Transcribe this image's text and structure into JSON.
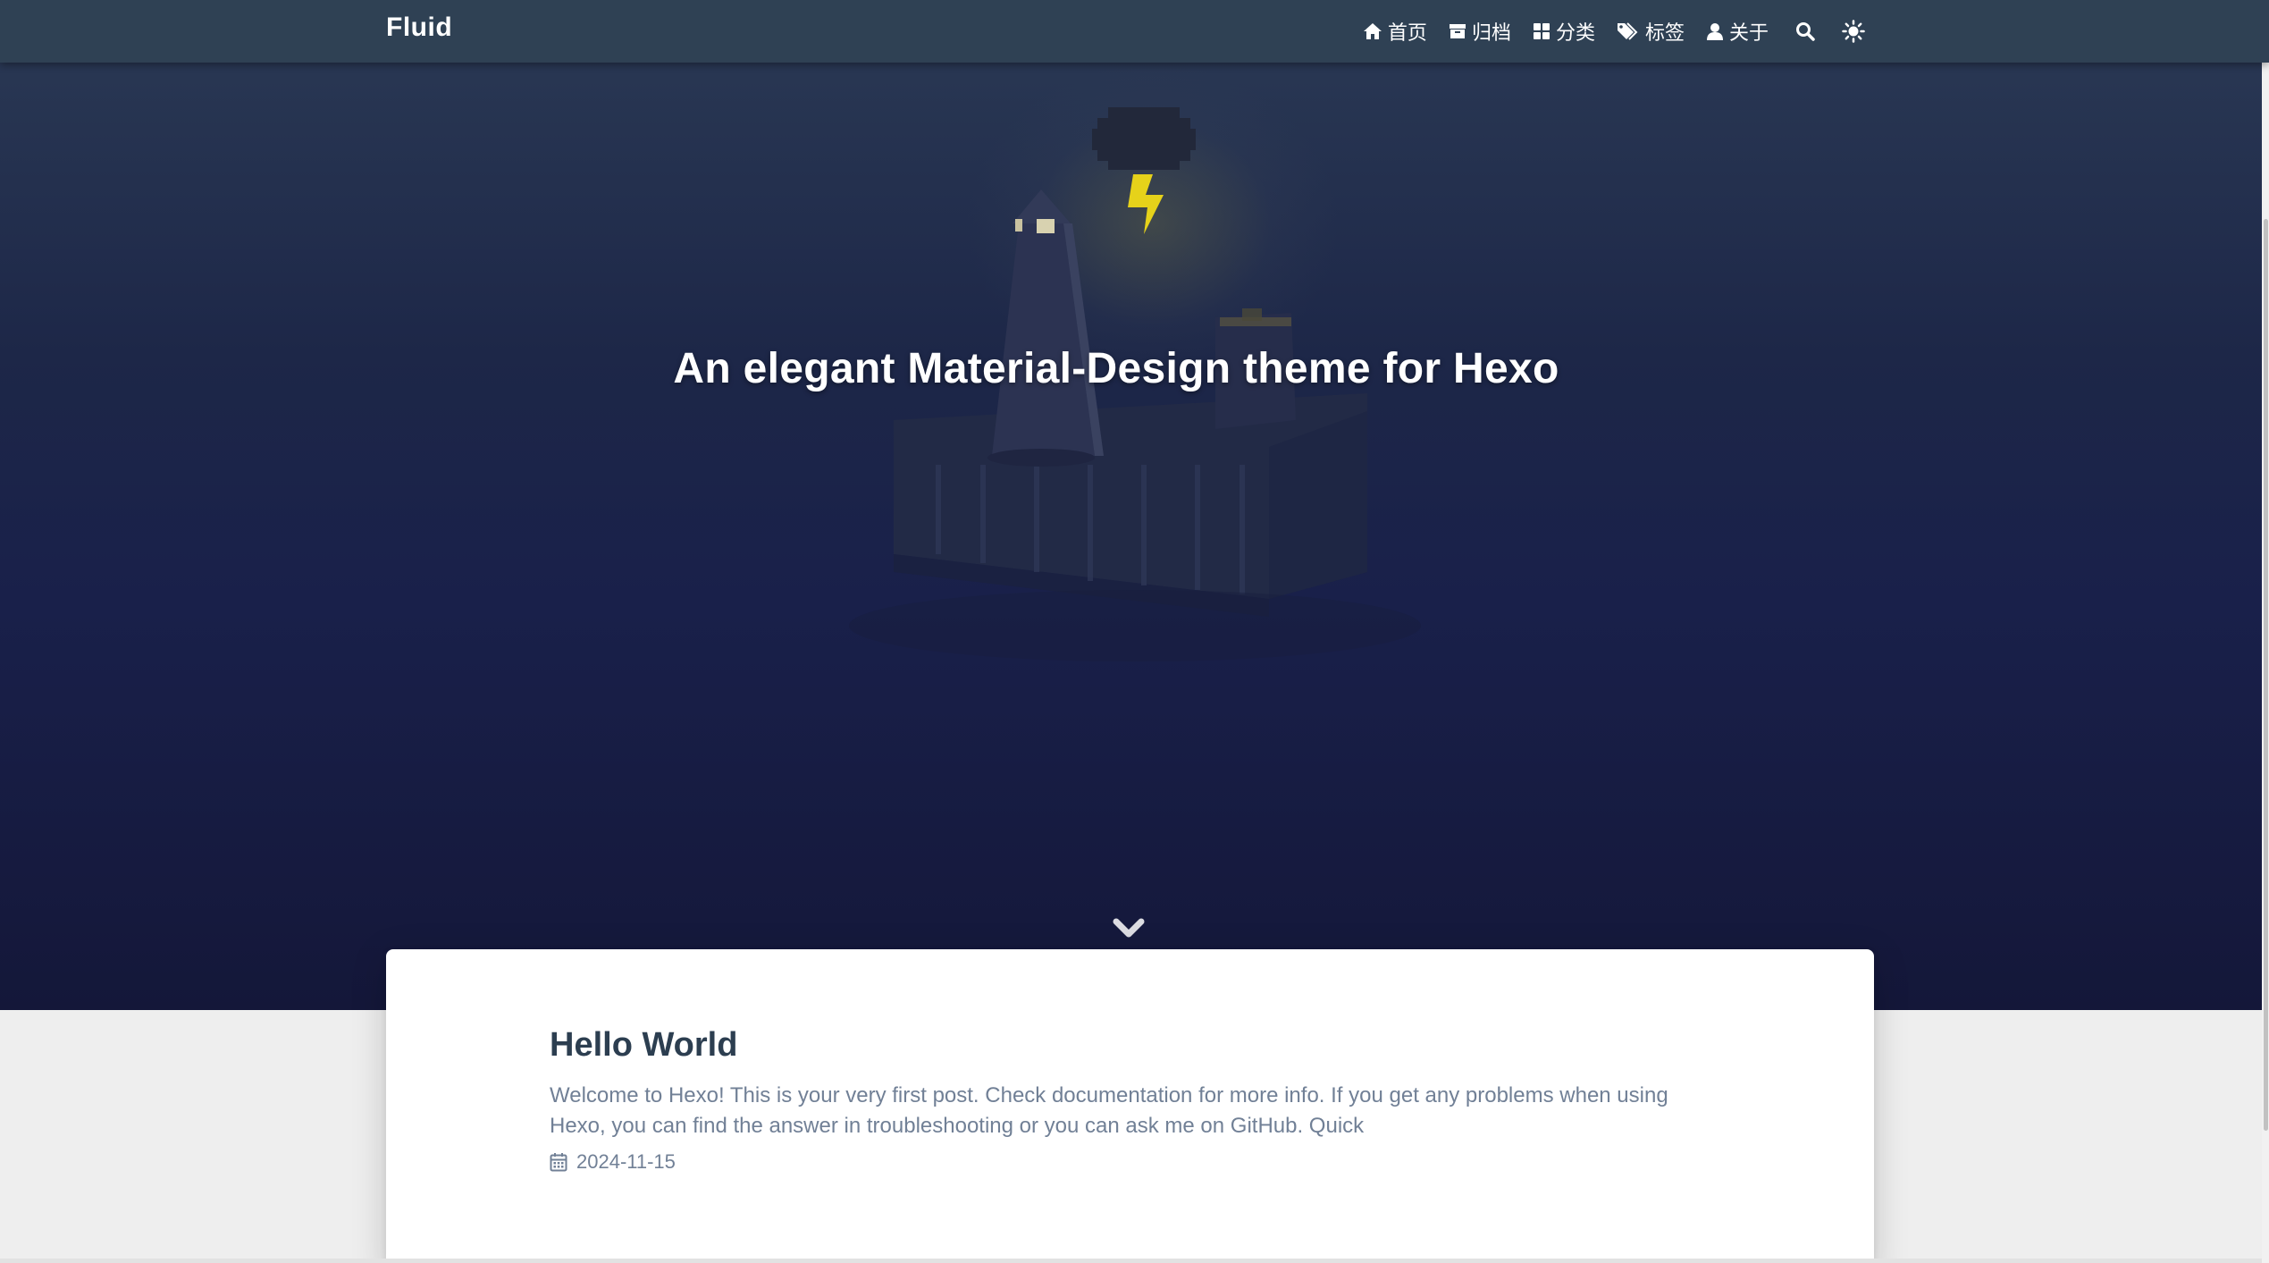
{
  "navbar": {
    "brand": "Fluid",
    "items": [
      {
        "label": "首页",
        "icon": "home-icon"
      },
      {
        "label": "归档",
        "icon": "archive-icon"
      },
      {
        "label": "分类",
        "icon": "th-large-icon"
      },
      {
        "label": "标签",
        "icon": "tags-icon"
      },
      {
        "label": "关于",
        "icon": "user-icon"
      }
    ],
    "search_icon": "search-icon",
    "theme_icon": "sun-icon"
  },
  "hero": {
    "title": "An elegant Material-Design theme for Hexo",
    "scroll_icon": "chevron-down-icon"
  },
  "posts": [
    {
      "title": "Hello World",
      "excerpt": "Welcome to Hexo! This is your very first post. Check documentation for more info. If you get any problems when using Hexo, you can find the answer in troubleshooting or you can ask me on GitHub. Quick",
      "date": "2024-11-15",
      "date_icon": "calendar-icon"
    }
  ],
  "colors": {
    "navbar": "#2f4154",
    "hero_dark": "#141739",
    "lightning": "#e6d21a",
    "title": "#2c3e50",
    "text_muted": "#718096",
    "page_background": "#eeeeee"
  }
}
